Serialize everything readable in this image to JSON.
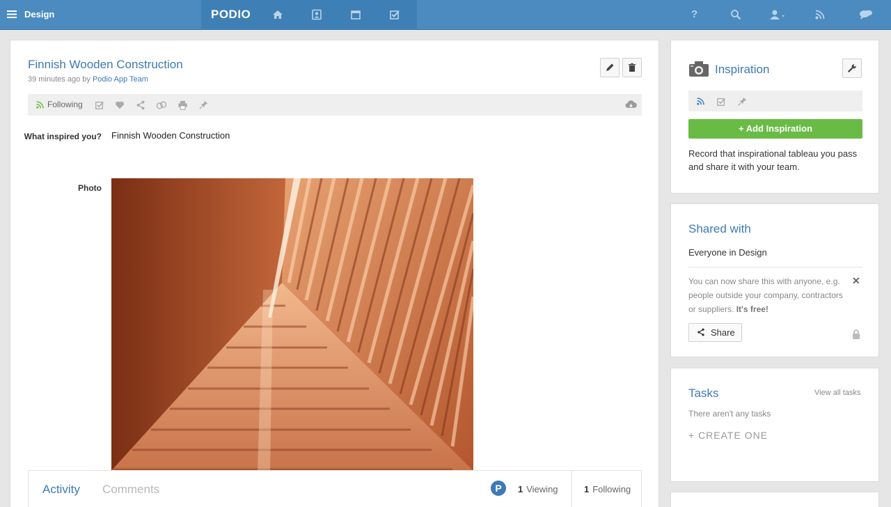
{
  "topbar": {
    "workspace": "Design",
    "brand": "PODIO",
    "icons": [
      "home-icon",
      "contacts-icon",
      "calendar-icon",
      "tasks-icon",
      "help-icon",
      "search-icon",
      "user-menu-icon",
      "activity-stream-icon",
      "chat-icon"
    ],
    "color": "#4b8bc0"
  },
  "item": {
    "title": "Finnish Wooden Construction",
    "meta_prefix": "39 minutes ago by",
    "author": "Podio App Team",
    "following_label": "Following",
    "fields": [
      {
        "label": "What inspired you?",
        "value": "Finnish Wooden Construction"
      },
      {
        "label": "Photo"
      }
    ]
  },
  "activity": {
    "tabs": [
      "Activity",
      "Comments"
    ],
    "badge": "P",
    "viewing_count": "1",
    "viewing_label": "Viewing",
    "following_count": "1",
    "following_label": "Following"
  },
  "app_card": {
    "title": "Inspiration",
    "add_button": "+ Add Inspiration",
    "description": "Record that inspirational tableau you pass and share it with your team.",
    "button_color": "#69bb45"
  },
  "shared": {
    "title": "Shared with",
    "everyone": "Everyone in Design",
    "note": "You can now share this with anyone, e.g. people outside your company, contractors or suppliers.",
    "note_bold": "It's free!",
    "close": "✕",
    "share_button": "Share"
  },
  "tasks": {
    "title": "Tasks",
    "view_all": "View all tasks",
    "empty": "There aren't any tasks",
    "create": "+ CREATE ONE"
  }
}
